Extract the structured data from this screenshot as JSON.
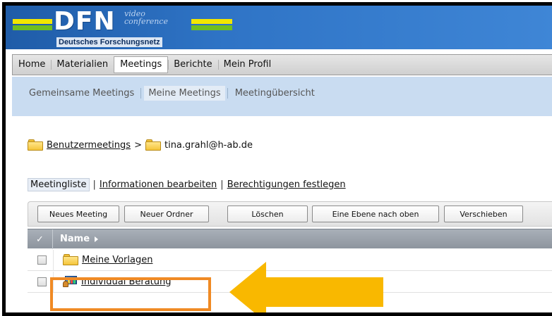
{
  "header": {
    "logo_text": "DFN",
    "logo_tagline_line1": "video",
    "logo_tagline_line2": "conference",
    "logo_subtitle": "Deutsches Forschungsnetz"
  },
  "main_nav": {
    "items": [
      {
        "label": "Home",
        "active": false
      },
      {
        "label": "Materialien",
        "active": false
      },
      {
        "label": "Meetings",
        "active": true
      },
      {
        "label": "Berichte",
        "active": false
      },
      {
        "label": "Mein Profil",
        "active": false
      }
    ]
  },
  "sub_nav": {
    "items": [
      {
        "label": "Gemeinsame Meetings",
        "active": false
      },
      {
        "label": "Meine Meetings",
        "active": true
      },
      {
        "label": "Meetingübersicht",
        "active": false
      }
    ]
  },
  "breadcrumb": {
    "root": "Benutzermeetings",
    "separator": ">",
    "current": "tina.grahl@h-ab.de"
  },
  "tabs": {
    "active": "Meetingliste",
    "edit_info": "Informationen bearbeiten",
    "permissions": "Berechtigungen festlegen",
    "pipe": "|"
  },
  "toolbar": {
    "new_meeting": "Neues Meeting",
    "new_folder": "Neuer Ordner",
    "delete": "Löschen",
    "level_up": "Eine Ebene nach oben",
    "move": "Verschieben"
  },
  "grid": {
    "check_header": "✓",
    "name_header": "Name",
    "rows": [
      {
        "type": "folder",
        "name": "Meine Vorlagen",
        "icon": "folder-icon"
      },
      {
        "type": "meeting",
        "name": "Individual Beratung",
        "icon": "meeting-icon"
      }
    ]
  },
  "annotation": {
    "highlight_color": "#f08a24",
    "arrow_color": "#f9b800"
  }
}
